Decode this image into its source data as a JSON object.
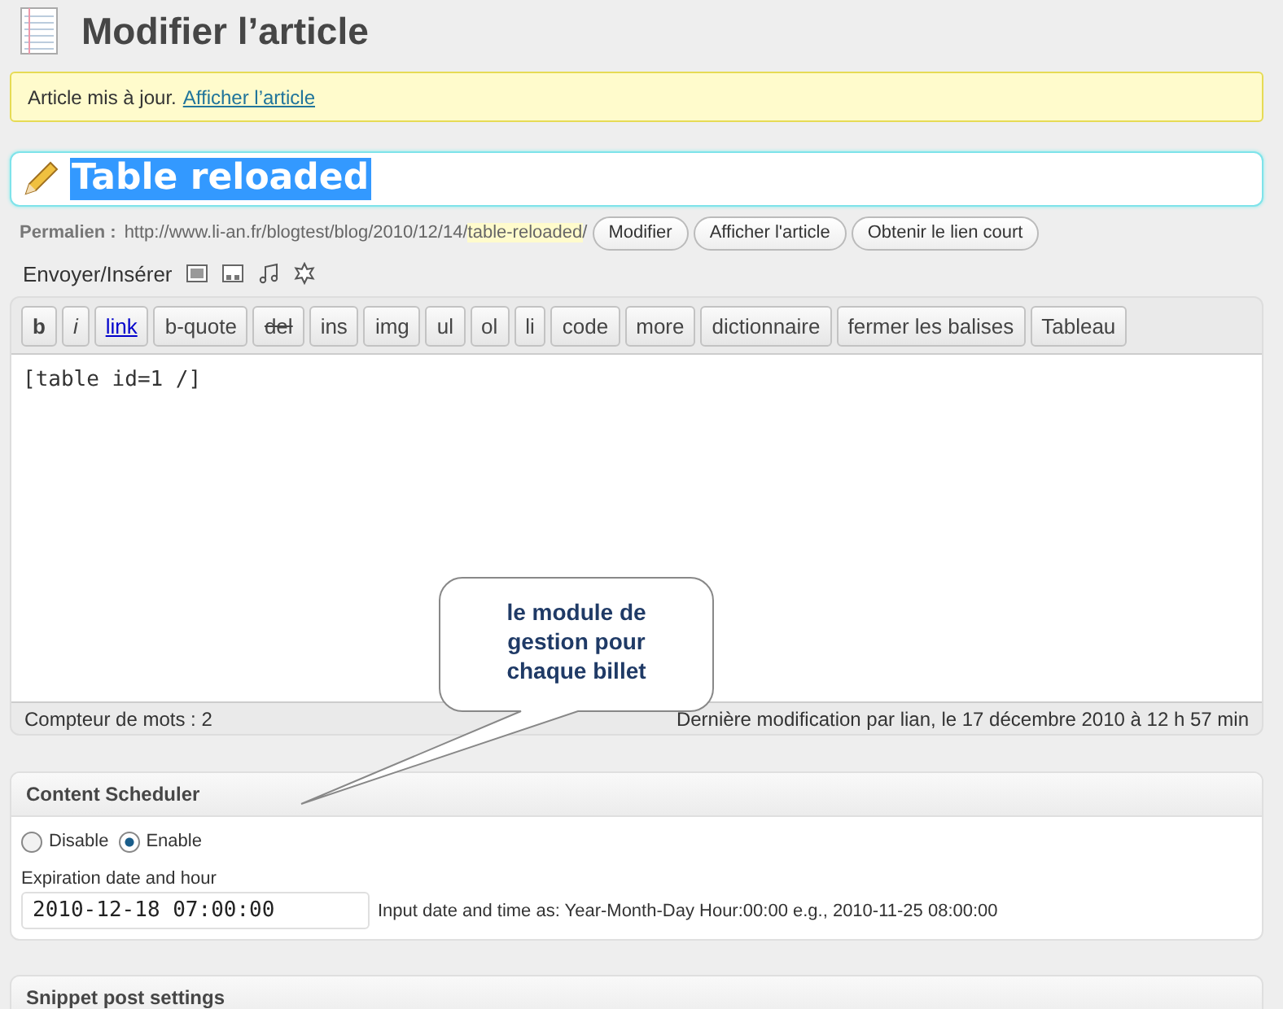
{
  "page_title": "Modifier l’article",
  "notice": {
    "text": "Article mis à jour.",
    "link": "Afficher l’article"
  },
  "post_title": {
    "value": "Table reloaded",
    "selected": true
  },
  "permalink": {
    "label": "Permalien :",
    "url": "http://www.li-an.fr/blogtest/blog/2010/12/14/",
    "slug": "table-reloaded",
    "suffix": "/",
    "buttons": [
      "Modifier",
      "Afficher l'article",
      "Obtenir le lien court"
    ]
  },
  "media": {
    "label": "Envoyer/Insérer"
  },
  "quicktags": [
    {
      "label": "b",
      "kind": "bold"
    },
    {
      "label": "i",
      "kind": "italic"
    },
    {
      "label": "link",
      "kind": "link"
    },
    {
      "label": "b-quote",
      "kind": "plain"
    },
    {
      "label": "del",
      "kind": "strike"
    },
    {
      "label": "ins",
      "kind": "plain"
    },
    {
      "label": "img",
      "kind": "plain"
    },
    {
      "label": "ul",
      "kind": "plain"
    },
    {
      "label": "ol",
      "kind": "plain"
    },
    {
      "label": "li",
      "kind": "plain"
    },
    {
      "label": "code",
      "kind": "plain"
    },
    {
      "label": "more",
      "kind": "plain"
    },
    {
      "label": "dictionnaire",
      "kind": "plain"
    },
    {
      "label": "fermer les balises",
      "kind": "plain"
    },
    {
      "label": "Tableau",
      "kind": "plain"
    }
  ],
  "editor": {
    "content": "[table id=1 /]",
    "word_count": "Compteur de mots : 2",
    "last_modified": "Dernière modification par lian, le 17 décembre 2010 à 12 h 57 min"
  },
  "callout": {
    "text": "le module de gestion pour chaque billet"
  },
  "content_scheduler": {
    "title": "Content Scheduler",
    "options": [
      {
        "label": "Disable",
        "selected": false
      },
      {
        "label": "Enable",
        "selected": true
      }
    ],
    "field_label": "Expiration date and hour",
    "field_value": "2010-12-18 07:00:00",
    "hint": "Input date and time as: Year-Month-Day Hour:00:00 e.g., 2010-11-25 08:00:00"
  },
  "snippet": {
    "title": "Snippet post settings"
  }
}
